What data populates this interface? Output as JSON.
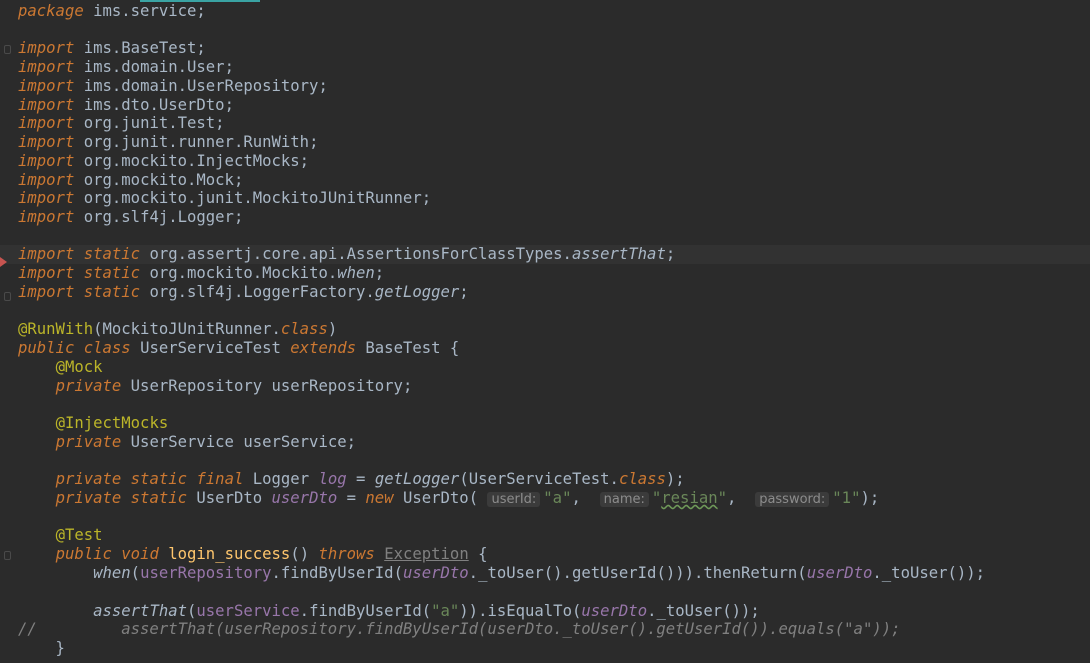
{
  "code": {
    "package": {
      "keyword": "package",
      "name": "ims.service",
      "semi": ";"
    },
    "imports": [
      "ims.BaseTest",
      "ims.domain.User",
      "ims.domain.UserRepository",
      "ims.dto.UserDto",
      "org.junit.Test",
      "org.junit.runner.RunWith",
      "org.mockito.InjectMocks",
      "org.mockito.Mock",
      "org.mockito.junit.MockitoJUnitRunner",
      "org.slf4j.Logger"
    ],
    "static_imports": [
      {
        "prefix": "org.assertj.core.api.AssertionsForClassTypes.",
        "member": "assertThat"
      },
      {
        "prefix": "org.mockito.Mockito.",
        "member": "when"
      },
      {
        "prefix": "org.slf4j.LoggerFactory.",
        "member": "getLogger"
      }
    ],
    "keywords": {
      "import": "import",
      "static": "static",
      "public": "public",
      "class": "class",
      "extends": "extends",
      "private": "private",
      "final": "final",
      "new": "new",
      "void": "void",
      "throws": "throws"
    },
    "annotations": {
      "run_with": "@RunWith",
      "mock": "@Mock",
      "inject_mocks": "@InjectMocks",
      "test": "@Test"
    },
    "class_decl": {
      "runner": "MockitoJUnitRunner",
      "name": "UserServiceTest",
      "parent": "BaseTest"
    },
    "fields": {
      "repo_type": "UserRepository",
      "repo_name": "userRepository",
      "service_type": "UserService",
      "service_name": "userService",
      "logger_type": "Logger",
      "logger_name": "log",
      "logger_init": "getLogger",
      "dto_type": "UserDto",
      "dto_name": "userDto"
    },
    "param_hints": {
      "user_id": "userId:",
      "name": "name:",
      "password": "password:"
    },
    "string_values": {
      "a": "\"a\"",
      "resian_open": "\"",
      "resian": "resian",
      "resian_close": "\"",
      "one": "\"1\""
    },
    "method": {
      "name": "login_success",
      "exception": "Exception",
      "when_call": "when",
      "find_method": "findByUserId",
      "to_user": "_toUser",
      "get_user_id": "getUserId",
      "then_return": "thenReturn",
      "assert_that": "assertThat",
      "is_equal_to": "isEqualTo"
    },
    "comment_line": "//         assertThat(userRepository.findByUserId(userDto._toUser().getUserId()).equals(\"a\"));"
  }
}
